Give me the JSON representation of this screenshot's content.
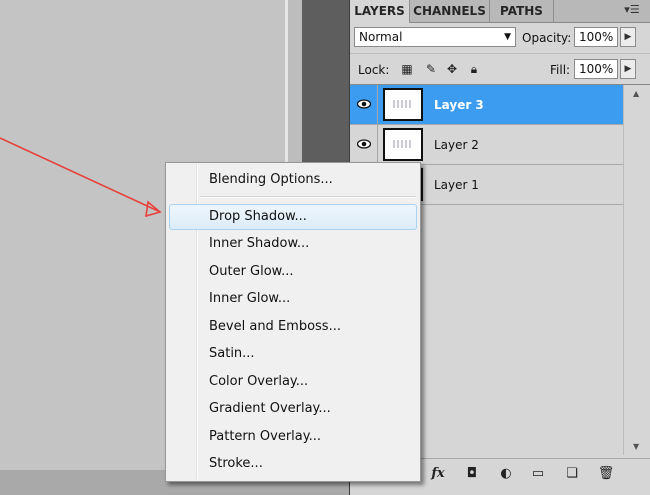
{
  "panel": {
    "tabs": [
      {
        "label": "LAYERS",
        "active": true
      },
      {
        "label": "CHANNELS",
        "active": false
      },
      {
        "label": "PATHS",
        "active": false
      }
    ],
    "menu_icon": "panel-menu-icon",
    "blend_mode": "Normal",
    "opacity_label": "Opacity:",
    "opacity_value": "100%",
    "lock_label": "Lock:",
    "fill_label": "Fill:",
    "fill_value": "100%",
    "layers": [
      {
        "name": "Layer 3",
        "visible": true,
        "selected": true
      },
      {
        "name": "Layer 2",
        "visible": true,
        "selected": false
      },
      {
        "name": "Layer 1",
        "visible": false,
        "selected": false
      }
    ],
    "bottom_icons": [
      "link-icon",
      "fx-icon",
      "mask-icon",
      "adjustment-icon",
      "group-folder-icon",
      "new-layer-icon",
      "trash-icon"
    ],
    "fx_label": "fx"
  },
  "context_menu": {
    "items": [
      {
        "label": "Blending Options...",
        "highlighted": false
      },
      {
        "label": "Drop Shadow...",
        "highlighted": true
      },
      {
        "label": "Inner Shadow...",
        "highlighted": false
      },
      {
        "label": "Outer Glow...",
        "highlighted": false
      },
      {
        "label": "Inner Glow...",
        "highlighted": false
      },
      {
        "label": "Bevel and Emboss...",
        "highlighted": false
      },
      {
        "label": "Satin...",
        "highlighted": false
      },
      {
        "label": "Color Overlay...",
        "highlighted": false
      },
      {
        "label": "Gradient Overlay...",
        "highlighted": false
      },
      {
        "label": "Pattern Overlay...",
        "highlighted": false
      },
      {
        "label": "Stroke...",
        "highlighted": false
      }
    ]
  },
  "colors": {
    "selection": "#3b9cf0",
    "arrow": "#e8403c",
    "menu_highlight_border": "#a8d2ef"
  }
}
